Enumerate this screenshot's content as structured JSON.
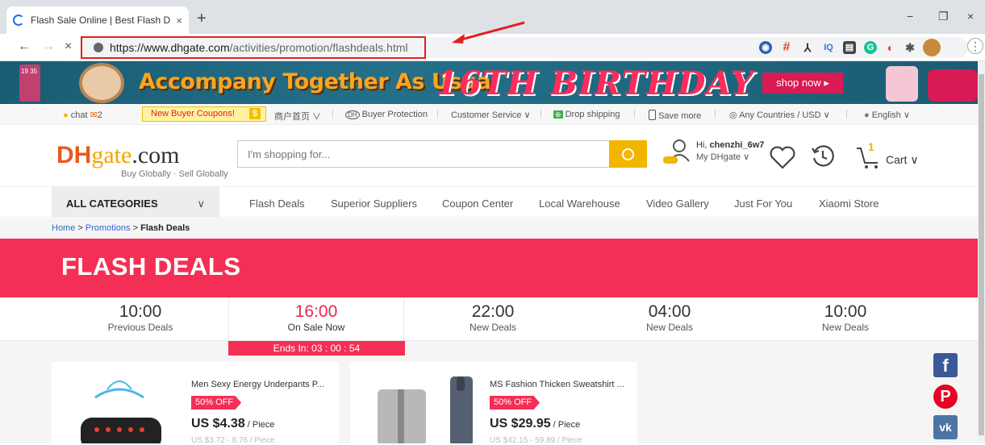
{
  "browser": {
    "tab_title": "Flash Sale Online | Best Flash D",
    "tab_close": "×",
    "new_tab": "+",
    "url_host": "https://www.dhgate.com",
    "url_path": "/activities/promotion/flashdeals.html",
    "back": "←",
    "forward": "→",
    "stop": "×",
    "minimize": "−",
    "maximize": "❐",
    "close": "×",
    "extensions": [
      "◉",
      "#",
      "⅄",
      "IQ",
      "▤",
      "G",
      "◐",
      "✱"
    ],
    "menu": "⋮"
  },
  "banner": {
    "tagline": "Accompany Together As Usual",
    "birthday": "16TH BIRTHDAY",
    "shop_now": "shop now ▸",
    "phone_text": "19 35"
  },
  "topbar": {
    "chat": "chat",
    "msg_count": "2",
    "coupon": "New Buyer Coupons!",
    "coupon_icon": "$",
    "merchant": "商户首页 ∨",
    "buyer_protection": "Buyer Protection",
    "customer_service": "Customer Service ∨",
    "drop_shipping": "Drop shipping",
    "save_more": "Save more",
    "country_currency": "Any Countries / USD ∨",
    "language": "English ∨"
  },
  "header": {
    "logo_dh": "DH",
    "logo_gate": "gate",
    "logo_com": ".com",
    "tagline": "Buy Globally · Sell Globally",
    "search_placeholder": "I'm shopping for...",
    "greeting": "Hi,",
    "username": "chenzhi_6w7",
    "my_dhgate": "My DHgate ∨",
    "cart_count": "1",
    "cart_label": "Cart ∨"
  },
  "nav": {
    "all_categories": "ALL CATEGORIES",
    "all_categories_chevron": "∨",
    "links": [
      "Flash Deals",
      "Superior Suppliers",
      "Coupon Center",
      "Local Warehouse",
      "Video Gallery",
      "Just For You",
      "Xiaomi Store"
    ]
  },
  "breadcrumb": {
    "home": "Home",
    "sep1": ">",
    "promotions": "Promotions",
    "sep2": ">",
    "current": "Flash Deals"
  },
  "hero": {
    "title": "FLASH DEALS"
  },
  "slots": [
    {
      "time": "10:00",
      "label": "Previous Deals"
    },
    {
      "time": "16:00",
      "label": "On Sale Now"
    },
    {
      "time": "22:00",
      "label": "New Deals"
    },
    {
      "time": "04:00",
      "label": "New Deals"
    },
    {
      "time": "10:00",
      "label": "New Deals"
    }
  ],
  "ends_in": "Ends In: 03 : 00 : 54",
  "products": [
    {
      "name": "Men Sexy Energy Underpants P...",
      "discount": "50% OFF",
      "price": "US $4.38",
      "unit": " / Piece",
      "range": "US $3.72 - 8.76 / Piece"
    },
    {
      "name": "MS Fashion Thicken Sweatshirt ...",
      "discount": "50% OFF",
      "price": "US $29.95",
      "unit": " / Piece",
      "range": "US $42.15 - 59.89 / Piece"
    }
  ],
  "social": [
    "f",
    "P",
    "vk"
  ],
  "colors": {
    "accent": "#f42f55",
    "search_button": "#f2b500",
    "highlight_box": "#e02020"
  }
}
